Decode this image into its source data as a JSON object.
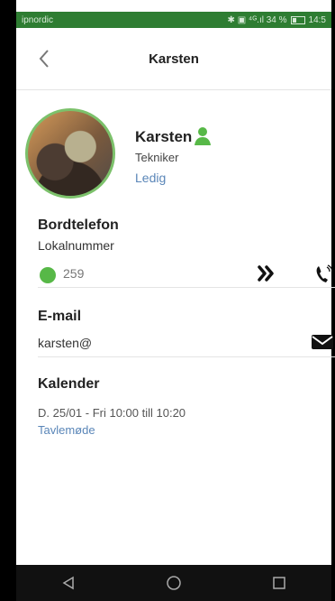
{
  "status_bar": {
    "carrier": "ipnordic",
    "right_text": "✱ ▣ ⁴ᴳ.ıl 34 %",
    "time": "14:5"
  },
  "header": {
    "title": "Karsten",
    "back_icon": "chevron-left-icon"
  },
  "profile": {
    "name": "Karsten",
    "role": "Tekniker",
    "status": "Ledig",
    "person_icon": "person-icon",
    "avatar_icon": "avatar"
  },
  "desk_phone": {
    "section_title": "Bordtelefon",
    "label": "Lokalnummer",
    "number": "259",
    "presence_icon": "green-dot-icon",
    "forward_icon": "forward-icon",
    "call_icon": "phone-icon"
  },
  "email": {
    "section_title": "E-mail",
    "value": "karsten@",
    "mail_icon": "mail-icon"
  },
  "calendar": {
    "section_title": "Kalender",
    "entry": "D. 25/01 - Fri   10:00 till 10:20",
    "description": "Tavlemøde"
  },
  "navigation": {
    "back_icon": "nav-back-icon",
    "home_icon": "nav-home-icon",
    "recent_icon": "nav-recent-icon"
  },
  "colors": {
    "status_bar": "#2e7d32",
    "accent_green": "#57b847",
    "link_blue": "#5a86b8"
  }
}
